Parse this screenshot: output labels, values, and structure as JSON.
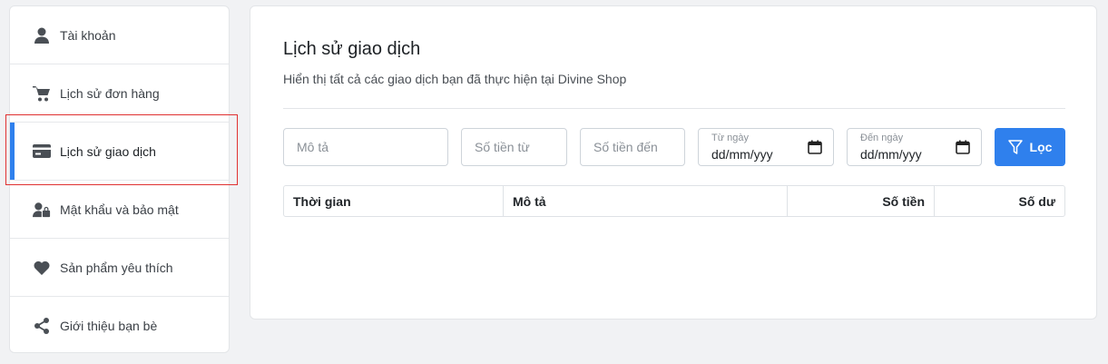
{
  "sidebar": {
    "items": [
      {
        "label": "Tài khoản",
        "icon": "user-icon"
      },
      {
        "label": "Lịch sử đơn hàng",
        "icon": "cart-icon"
      },
      {
        "label": "Lịch sử giao dịch",
        "icon": "credit-card-icon",
        "active": true
      },
      {
        "label": "Mật khẩu và bảo mật",
        "icon": "user-lock-icon"
      },
      {
        "label": "Sản phẩm yêu thích",
        "icon": "heart-icon"
      },
      {
        "label": "Giới thiệu bạn bè",
        "icon": "share-icon"
      }
    ]
  },
  "main": {
    "title": "Lịch sử giao dịch",
    "subtitle": "Hiển thị tất cả các giao dịch bạn đã thực hiện tại Divine Shop",
    "filters": {
      "description_placeholder": "Mô tả",
      "amount_from_placeholder": "Số tiền từ",
      "amount_to_placeholder": "Số tiền đến",
      "date_from_label": "Từ ngày",
      "date_from_value": "dd/mm/yyy",
      "date_to_label": "Đến ngày",
      "date_to_value": "dd/mm/yyy",
      "filter_button": "Lọc"
    },
    "table": {
      "columns": [
        "Thời gian",
        "Mô tả",
        "Số tiền",
        "Số dư"
      ]
    }
  },
  "colors": {
    "accent": "#2f80ed",
    "highlight": "#e03131"
  }
}
